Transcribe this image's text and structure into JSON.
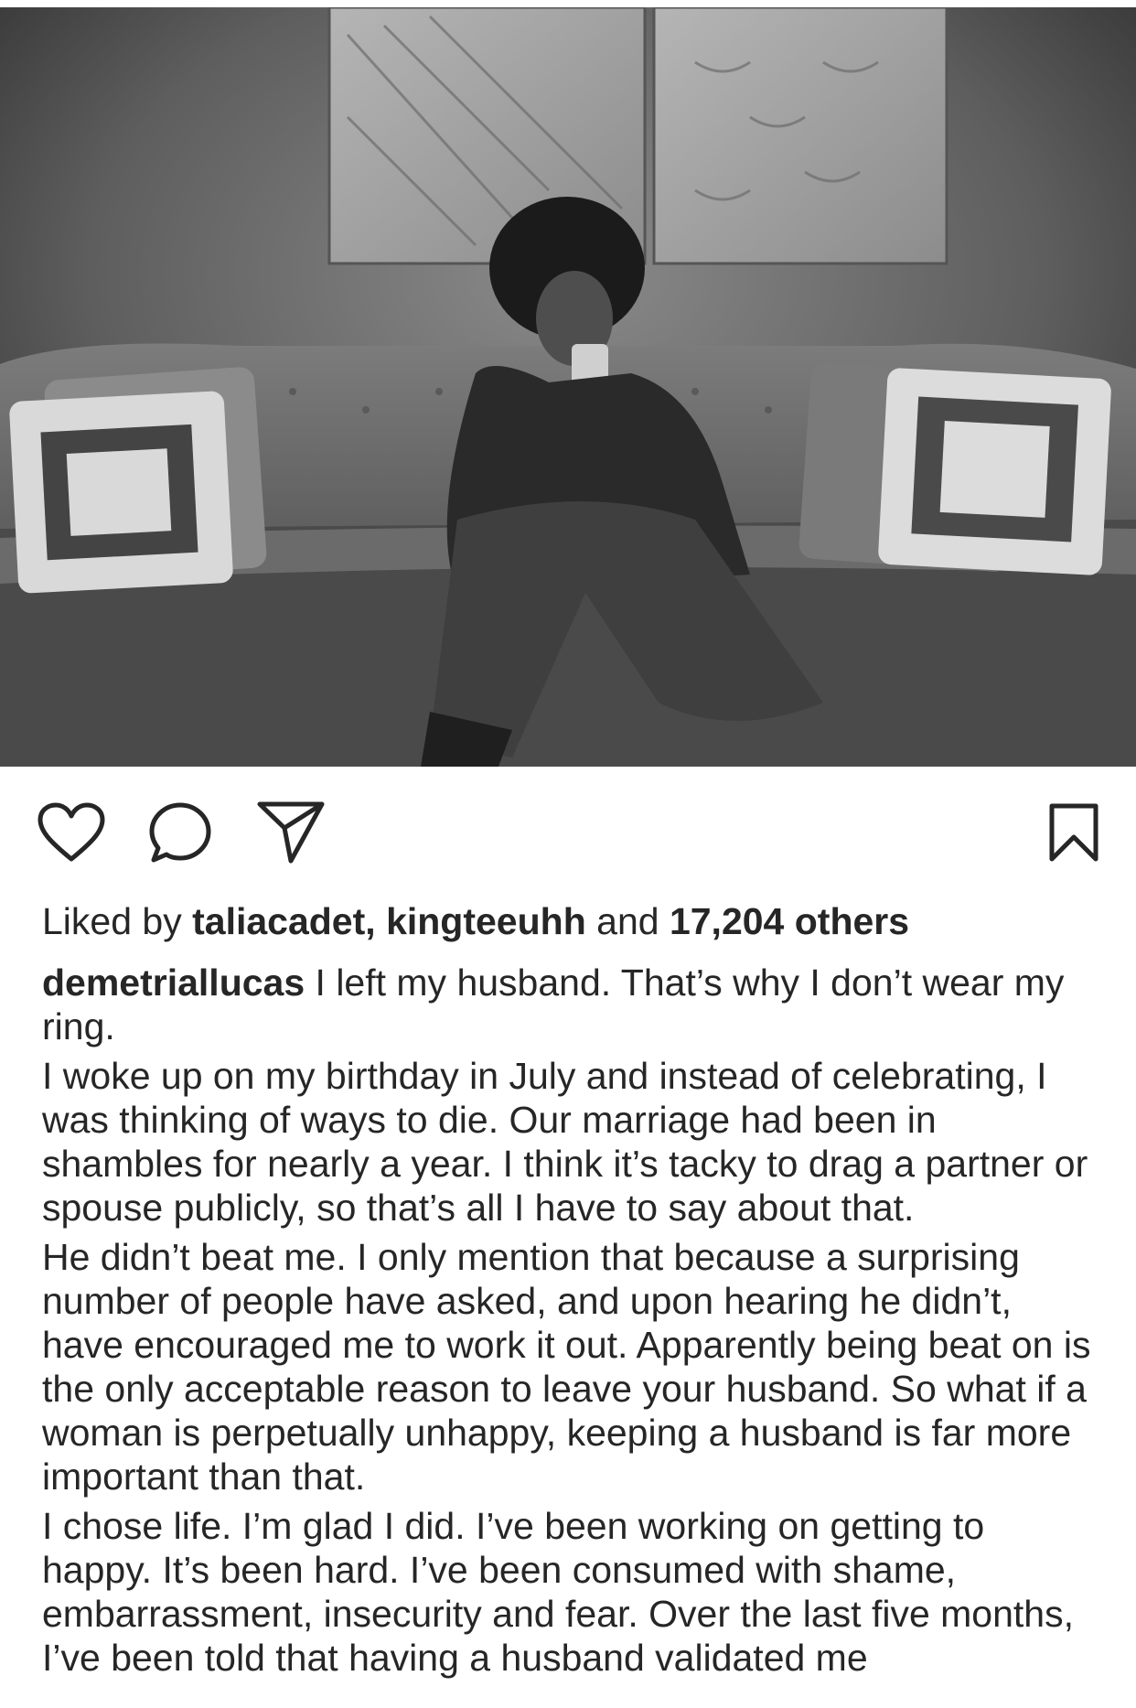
{
  "post": {
    "image_description_icon": "photo",
    "actions": {
      "like_icon": "heart-icon",
      "comment_icon": "comment-icon",
      "share_icon": "paper-plane-icon",
      "save_icon": "bookmark-icon"
    },
    "likes": {
      "prefix": "Liked by ",
      "user1": "taliacadet",
      "separator": ", ",
      "user2": "kingteeuhh",
      "and": " and ",
      "others": "17,204 others"
    },
    "caption": {
      "username": "demetriallucas",
      "first_line": " I left my husband.  That’s why I don’t wear my ring.",
      "paragraphs": [
        "I woke up on my birthday in July and instead of celebrating, I was thinking of ways to die. Our marriage had been in shambles for nearly a year. I think it’s tacky to drag a partner or spouse publicly, so that’s all I have to say about that.",
        "He didn’t beat me. I only mention that because a surprising number of people have asked, and upon hearing he didn’t, have encouraged me to work it out. Apparently being beat on is the only acceptable reason to leave your husband. So what if a woman is perpetually unhappy, keeping a husband is far more important than that.",
        "I chose life. I’m glad I did. I’ve been working on getting to happy. It’s been hard. I’ve been consumed with shame, embarrassment, insecurity and fear. Over the last five months, I’ve been told that having a husband validated me"
      ]
    }
  }
}
